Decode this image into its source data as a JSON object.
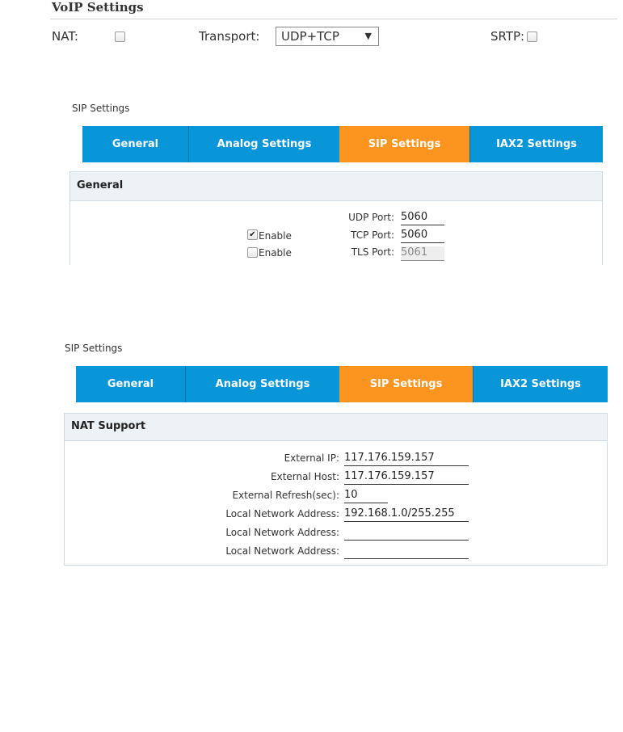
{
  "voip": {
    "title": "VoIP Settings",
    "nat_label": "NAT:",
    "nat_checked": false,
    "transport_label": "Transport:",
    "transport_value": "UDP+TCP",
    "transport_arrow": "▼",
    "srtp_label": "SRTP:",
    "srtp_checked": false
  },
  "panel1": {
    "title": "SIP Settings",
    "tabs": [
      {
        "label": "General",
        "active": false
      },
      {
        "label": "Analog Settings",
        "active": false
      },
      {
        "label": "SIP Settings",
        "active": true
      },
      {
        "label": "IAX2 Settings",
        "active": false
      }
    ],
    "section": "General",
    "rows": [
      {
        "enable_label": "",
        "enable_checked": null,
        "port_label": "UDP Port:",
        "port_value": "5060",
        "disabled": false
      },
      {
        "enable_label": "Enable",
        "enable_checked": true,
        "port_label": "TCP Port:",
        "port_value": "5060",
        "disabled": false
      },
      {
        "enable_label": "Enable",
        "enable_checked": false,
        "port_label": "TLS Port:",
        "port_value": "5061",
        "disabled": true
      }
    ]
  },
  "panel2": {
    "title": "SIP Settings",
    "tabs": [
      {
        "label": "General",
        "active": false
      },
      {
        "label": "Analog Settings",
        "active": false
      },
      {
        "label": "SIP Settings",
        "active": true
      },
      {
        "label": "IAX2 Settings",
        "active": false
      }
    ],
    "section": "NAT Support",
    "rows": [
      {
        "label": "External IP:",
        "value": "117.176.159.157"
      },
      {
        "label": "External Host:",
        "value": "117.176.159.157"
      },
      {
        "label": "External Refresh(sec):",
        "value": "10"
      },
      {
        "label": "Local Network Address:",
        "value": "192.168.1.0/255.255"
      },
      {
        "label": "Local Network Address:",
        "value": ""
      },
      {
        "label": "Local Network Address:",
        "value": ""
      }
    ]
  },
  "colors": {
    "tab_blue": "#0996d8",
    "tab_active_orange": "#fb9520",
    "section_header_bg": "#edf2f7"
  }
}
